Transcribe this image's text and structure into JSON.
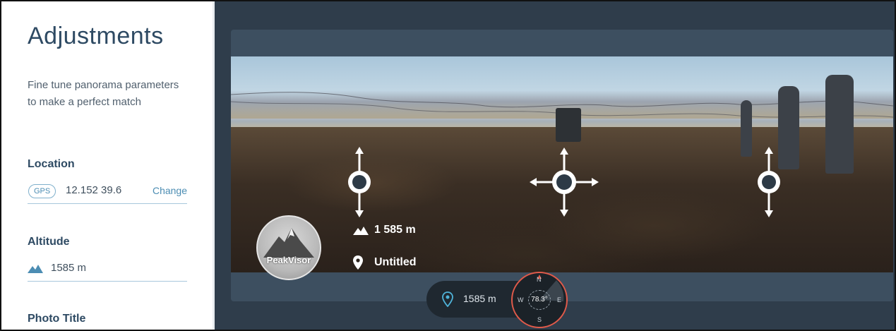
{
  "panel": {
    "title": "Adjustments",
    "description": "Fine tune panorama parameters to make a perfect match",
    "location_label": "Location",
    "gps_badge": "GPS",
    "coordinates": "12.152 39.6",
    "change_label": "Change",
    "altitude_label": "Altitude",
    "altitude_value": "1585 m",
    "photo_title_label": "Photo Title"
  },
  "overlay": {
    "brand": "PeakVisor",
    "altitude": "1 585 m",
    "title": "Untitled"
  },
  "bottom_bar": {
    "altitude": "1585 m",
    "compass_heading": "78.3°",
    "compass_n": "N",
    "compass_s": "S",
    "compass_e": "E",
    "compass_w": "W"
  },
  "icons": {
    "mountain": "mountain-icon",
    "pin": "location-pin-icon",
    "move_vertical": "move-vertical-handle",
    "move_all": "move-all-handle"
  },
  "colors": {
    "panel_bg": "#ffffff",
    "accent_blue": "#4c8db3",
    "viewer_bg": "#2f3d4b",
    "compass_ring": "#e05a4a"
  }
}
